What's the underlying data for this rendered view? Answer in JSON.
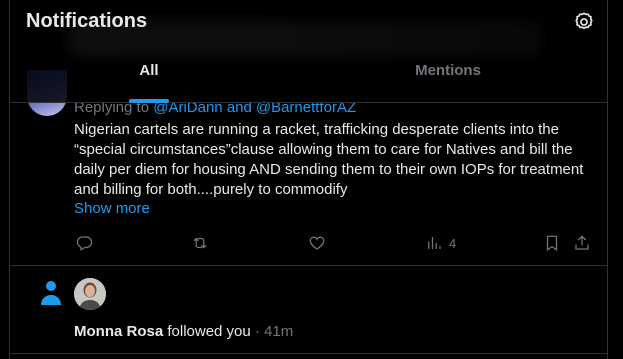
{
  "header": {
    "title": "Notifications",
    "settings_icon": "gear-icon",
    "tabs": [
      {
        "label": "All",
        "active": true
      },
      {
        "label": "Mentions",
        "active": false
      }
    ],
    "accent": "#1d9bf0"
  },
  "tweet": {
    "replying_prefix": "Replying to",
    "reply_handle_1": "@AriDann",
    "reply_and": "and",
    "reply_handle_2": "@BarnettforAZ",
    "text": "Nigerian cartels are running a racket, trafficking desperate clients into the “special circumstances”clause allowing them to care for Natives and bill the daily per diem for housing AND sending them to their own IOPs for treatment and billing for both....purely to commodify",
    "show_more": "Show more",
    "actions": {
      "reply_icon": "reply-icon",
      "retweet_icon": "retweet-icon",
      "like_icon": "heart-icon",
      "views_icon": "analytics-icon",
      "views_count": "4",
      "bookmark_icon": "bookmark-icon",
      "share_icon": "share-icon"
    }
  },
  "follow": {
    "icon": "person-icon",
    "name": "Monna Rosa",
    "action": "followed you",
    "separator": "·",
    "time": "41m"
  }
}
